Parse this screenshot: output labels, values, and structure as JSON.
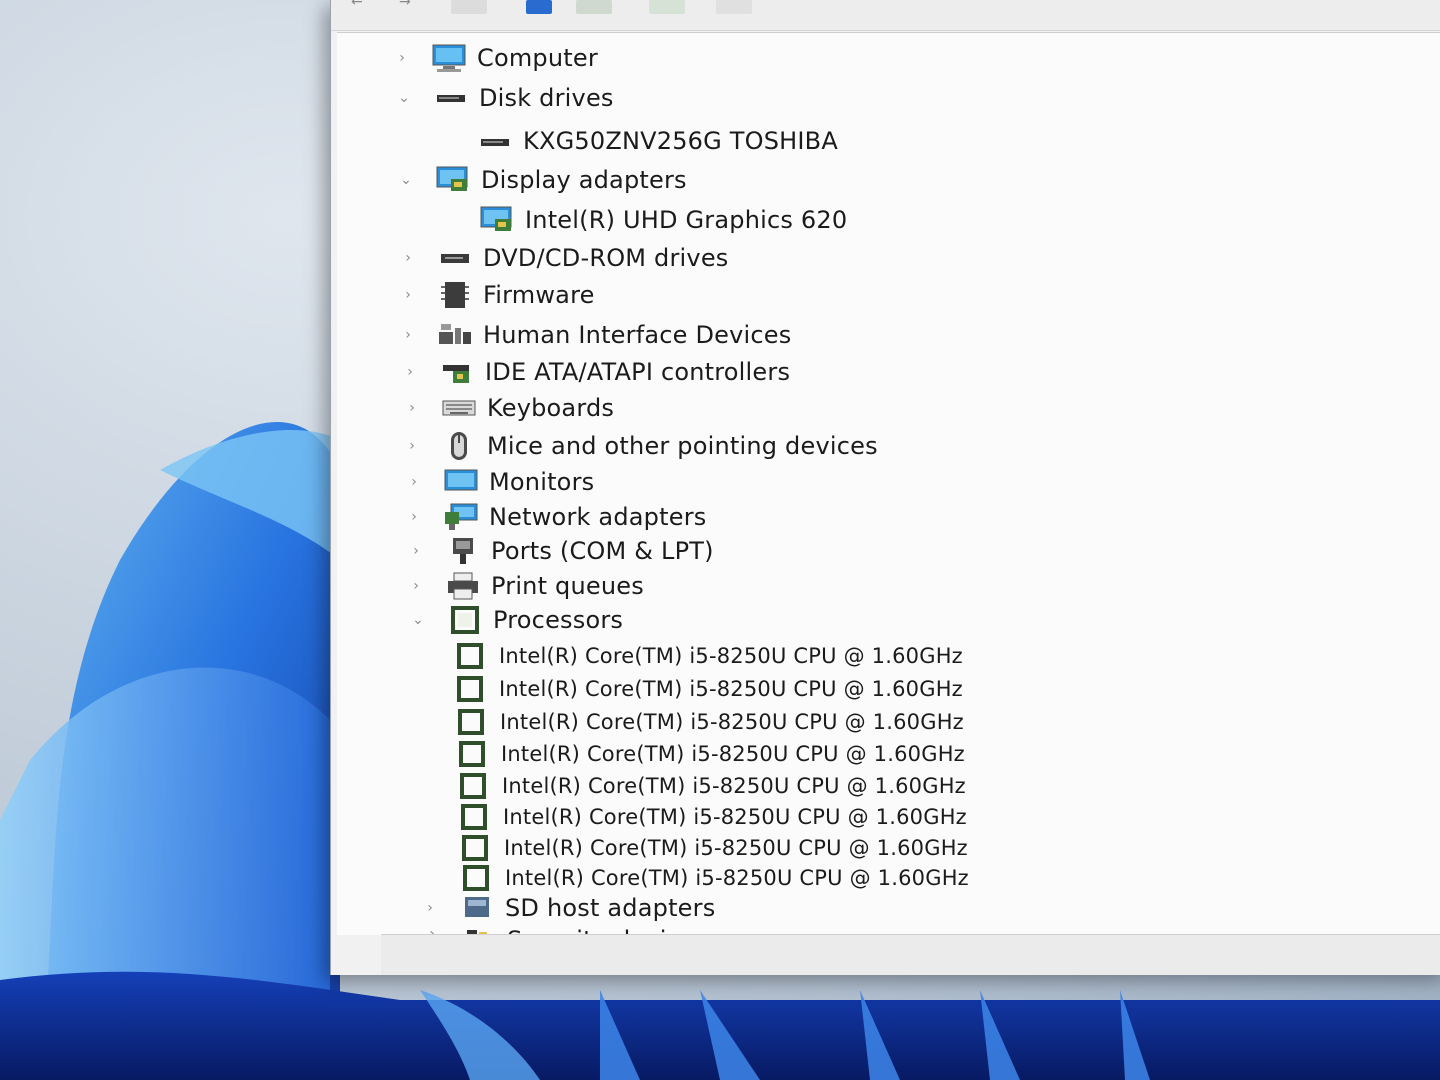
{
  "device_tree": {
    "categories": [
      {
        "label": "Computer",
        "icon": "computer-icon",
        "expanded": false
      },
      {
        "label": "Disk drives",
        "icon": "disk-drive-icon",
        "expanded": true,
        "children": [
          {
            "label": "KXG50ZNV256G TOSHIBA",
            "icon": "disk-drive-icon"
          }
        ]
      },
      {
        "label": "Display adapters",
        "icon": "display-adapter-icon",
        "expanded": true,
        "children": [
          {
            "label": "Intel(R) UHD Graphics 620",
            "icon": "display-adapter-icon"
          }
        ]
      },
      {
        "label": "DVD/CD-ROM drives",
        "icon": "dvd-drive-icon",
        "expanded": false
      },
      {
        "label": "Firmware",
        "icon": "firmware-icon",
        "expanded": false
      },
      {
        "label": "Human Interface Devices",
        "icon": "hid-icon",
        "expanded": false
      },
      {
        "label": "IDE ATA/ATAPI controllers",
        "icon": "ide-controller-icon",
        "expanded": false
      },
      {
        "label": "Keyboards",
        "icon": "keyboard-icon",
        "expanded": false
      },
      {
        "label": "Mice and other pointing devices",
        "icon": "mouse-icon",
        "expanded": false
      },
      {
        "label": "Monitors",
        "icon": "monitor-icon",
        "expanded": false
      },
      {
        "label": "Network adapters",
        "icon": "network-adapter-icon",
        "expanded": false
      },
      {
        "label": "Ports (COM & LPT)",
        "icon": "port-icon",
        "expanded": false
      },
      {
        "label": "Print queues",
        "icon": "printer-icon",
        "expanded": false
      },
      {
        "label": "Processors",
        "icon": "processor-icon",
        "expanded": true,
        "children": [
          {
            "label": "Intel(R) Core(TM) i5-8250U CPU @ 1.60GHz",
            "icon": "processor-icon"
          },
          {
            "label": "Intel(R) Core(TM) i5-8250U CPU @ 1.60GHz",
            "icon": "processor-icon"
          },
          {
            "label": "Intel(R) Core(TM) i5-8250U CPU @ 1.60GHz",
            "icon": "processor-icon"
          },
          {
            "label": "Intel(R) Core(TM) i5-8250U CPU @ 1.60GHz",
            "icon": "processor-icon"
          },
          {
            "label": "Intel(R) Core(TM) i5-8250U CPU @ 1.60GHz",
            "icon": "processor-icon"
          },
          {
            "label": "Intel(R) Core(TM) i5-8250U CPU @ 1.60GHz",
            "icon": "processor-icon"
          },
          {
            "label": "Intel(R) Core(TM) i5-8250U CPU @ 1.60GHz",
            "icon": "processor-icon"
          },
          {
            "label": "Intel(R) Core(TM) i5-8250U CPU @ 1.60GHz",
            "icon": "processor-icon"
          }
        ]
      },
      {
        "label": "SD host adapters",
        "icon": "sd-host-icon",
        "expanded": false
      },
      {
        "label": "Security devices",
        "icon": "security-device-icon",
        "expanded": false
      }
    ]
  },
  "colors": {
    "window_bg": "#f1f1f1",
    "tree_bg": "#fbfbfb",
    "text": "#1b1b1b",
    "icon_blue": "#2a8fd8",
    "icon_green": "#3f7d3a",
    "wallpaper_blue": "#1e5fd0"
  }
}
